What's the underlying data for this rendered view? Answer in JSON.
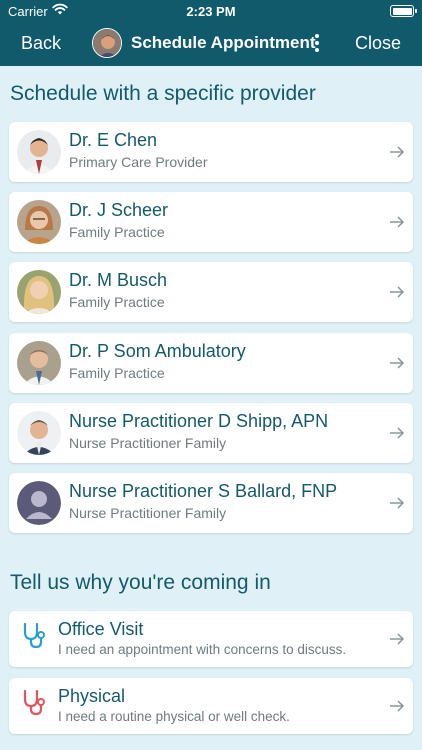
{
  "status_bar": {
    "carrier": "Carrier",
    "time": "2:23 PM"
  },
  "nav": {
    "back_label": "Back",
    "title": "Schedule Appointment",
    "close_label": "Close"
  },
  "providers_section": {
    "title": "Schedule with a specific provider",
    "providers": [
      {
        "name": "Dr. E Chen",
        "specialty": "Primary Care Provider"
      },
      {
        "name": "Dr. J Scheer",
        "specialty": "Family Practice"
      },
      {
        "name": "Dr. M Busch",
        "specialty": "Family Practice"
      },
      {
        "name": "Dr. P Som Ambulatory",
        "specialty": "Family Practice"
      },
      {
        "name": "Nurse Practitioner D Shipp, APN",
        "specialty": "Nurse Practitioner Family"
      },
      {
        "name": "Nurse Practitioner S Ballard, FNP",
        "specialty": "Nurse Practitioner Family"
      }
    ]
  },
  "reasons_section": {
    "title": "Tell us why you're coming in",
    "reasons": [
      {
        "title": "Office Visit",
        "description": "I need an appointment with concerns to discuss.",
        "icon": "stethoscope-icon",
        "icon_color": "#2a9fd6"
      },
      {
        "title": "Physical",
        "description": "I need a routine physical or well check.",
        "icon": "stethoscope-icon",
        "icon_color": "#e0565f"
      }
    ]
  },
  "colors": {
    "header": "#115a6b",
    "background": "#dff1f6",
    "accent_text": "#135a6a"
  }
}
